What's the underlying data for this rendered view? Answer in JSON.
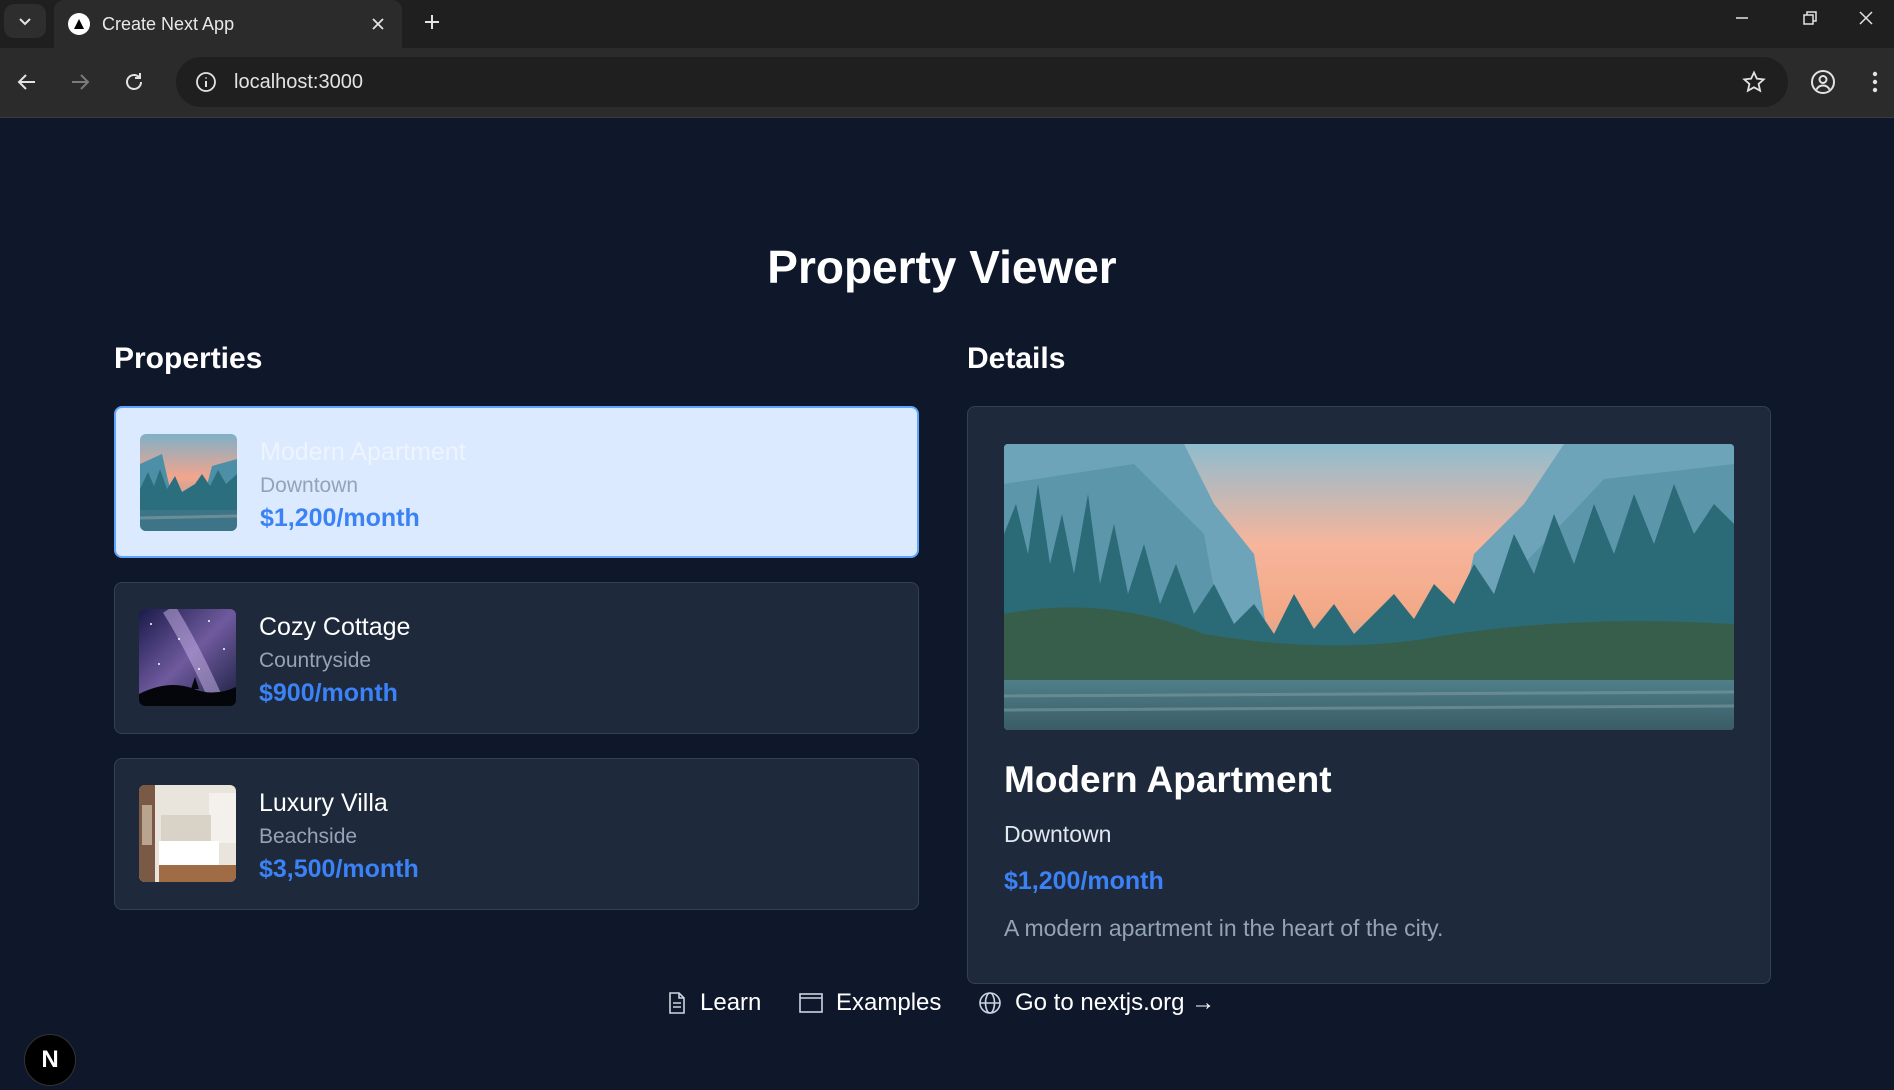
{
  "browser": {
    "tab_title": "Create Next App",
    "url": "localhost:3000"
  },
  "page": {
    "title": "Property Viewer",
    "properties_heading": "Properties",
    "details_heading": "Details"
  },
  "properties": [
    {
      "name": "Modern Apartment",
      "location": "Downtown",
      "price": "$1,200/month",
      "selected": true
    },
    {
      "name": "Cozy Cottage",
      "location": "Countryside",
      "price": "$900/month",
      "selected": false
    },
    {
      "name": "Luxury Villa",
      "location": "Beachside",
      "price": "$3,500/month",
      "selected": false
    }
  ],
  "details": {
    "name": "Modern Apartment",
    "location": "Downtown",
    "price": "$1,200/month",
    "description": "A modern apartment in the heart of the city."
  },
  "footer": {
    "learn": "Learn",
    "examples": "Examples",
    "nextjs": "Go to nextjs.org →"
  },
  "badge": {
    "letter": "N"
  },
  "colors": {
    "page_bg": "#0f172a",
    "card_bg": "#1e293b",
    "selected_bg": "#dbeafe",
    "accent": "#3b82f6"
  }
}
